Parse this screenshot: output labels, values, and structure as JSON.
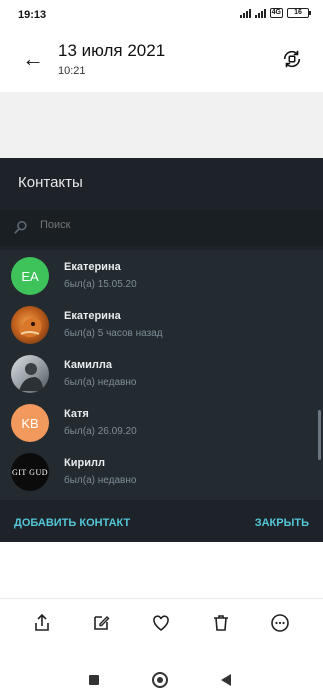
{
  "status_bar": {
    "time": "19:13",
    "battery": "16",
    "network": "4G"
  },
  "header": {
    "title": "13 июля 2021",
    "subtitle": "10:21",
    "back_icon": "arrow-left-icon",
    "rotate_icon": "rotate-icon"
  },
  "contacts": {
    "title": "Контакты",
    "search_placeholder": "Поиск",
    "items": [
      {
        "initials": "EA",
        "name": "Екатерина",
        "status": "был(а) 15.05.20",
        "avatar_color": "#3ec35a"
      },
      {
        "initials": "",
        "name": "Екатерина",
        "status": "был(а) 5 часов назад",
        "avatar_color": "#b5541a"
      },
      {
        "initials": "",
        "name": "Камилла",
        "status": "был(а) недавно",
        "avatar_color": "#8a8f94"
      },
      {
        "initials": "KB",
        "name": "Катя",
        "status": "был(а) 26.09.20",
        "avatar_color": "#f29a5d"
      },
      {
        "initials": "GIT GUD",
        "name": "Кирилл",
        "status": "был(а) недавно",
        "avatar_color": "#0b0b0b"
      }
    ],
    "add_button": "ДОБАВИТЬ КОНТАКТ",
    "close_button": "ЗАКРЫТЬ",
    "accent": "#53c6d8"
  },
  "toolbar": {
    "icons": [
      "share-icon",
      "edit-icon",
      "heart-icon",
      "trash-icon",
      "more-icon"
    ]
  }
}
